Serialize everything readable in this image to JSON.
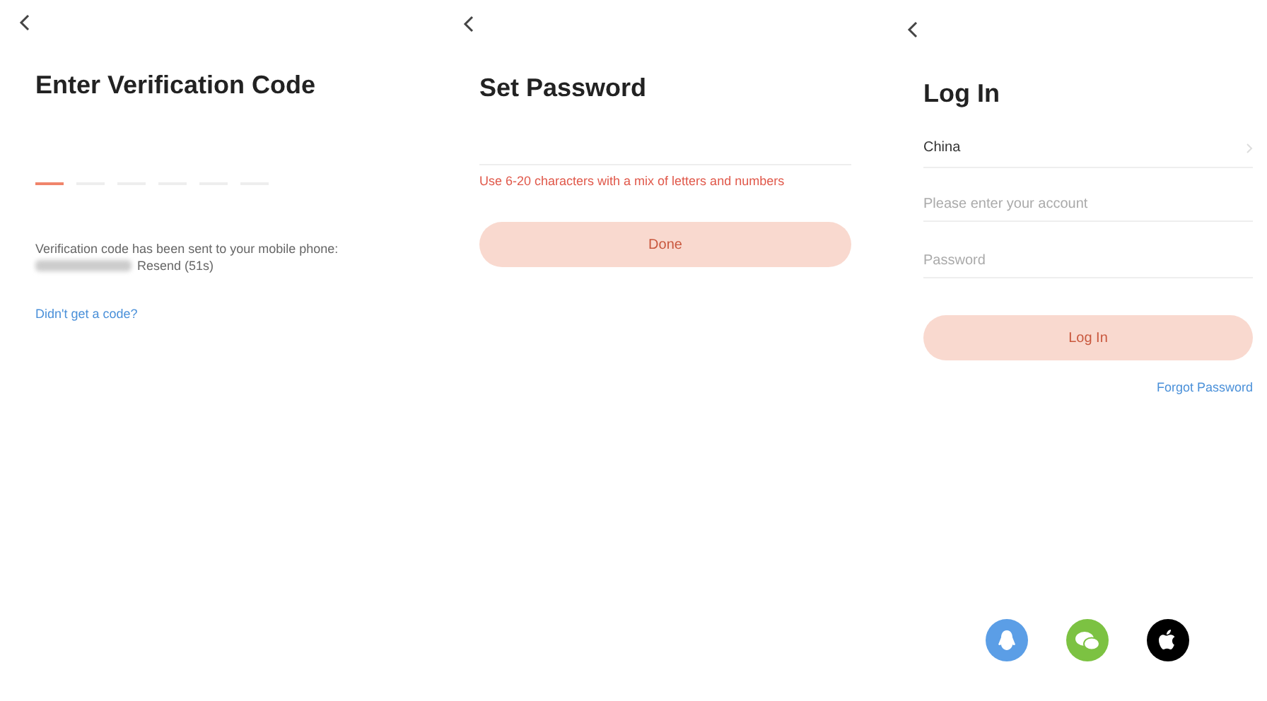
{
  "screens": [
    {
      "kind": "verify",
      "title": "Enter Verification Code",
      "code_cells": [
        {
          "selected": true
        },
        {
          "selected": false
        },
        {
          "selected": false
        },
        {
          "selected": false
        },
        {
          "selected": false
        },
        {
          "selected": false
        }
      ],
      "message": "Verification code has been sent to your mobile phone:",
      "resend": "Resend (51s)",
      "help_link": "Didn't get a code?"
    },
    {
      "kind": "password",
      "title": "Set Password",
      "hint": "Use 6-20 characters with a mix of letters and numbers",
      "button": {
        "label": "Done",
        "disabled": true
      }
    },
    {
      "kind": "login",
      "title": "Log In",
      "region": "China",
      "account_placeholder": "Please enter your account",
      "password_placeholder": "Password",
      "button": {
        "label": "Log In",
        "disabled": true
      },
      "forgot_link": "Forgot Password",
      "social": [
        {
          "kind": "penguin",
          "color": "#5b9ee6"
        },
        {
          "kind": "chat",
          "color": "#7cc242"
        },
        {
          "kind": "apple",
          "color": "#000000"
        }
      ]
    }
  ]
}
